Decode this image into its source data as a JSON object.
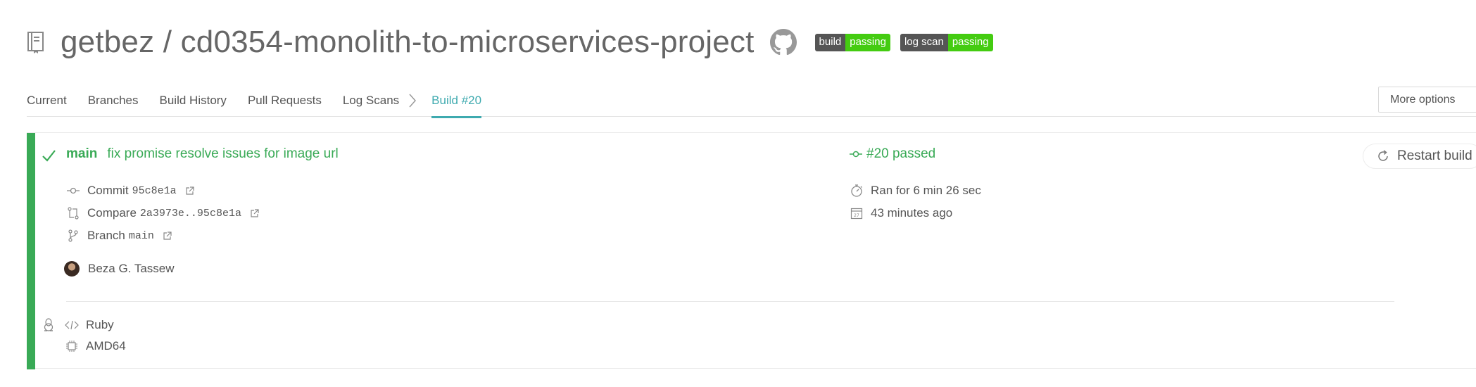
{
  "header": {
    "repo_title": "getbez / cd0354-monolith-to-microservices-project",
    "badges": [
      {
        "left": "build",
        "right": "passing"
      },
      {
        "left": "log scan",
        "right": "passing"
      }
    ]
  },
  "tabs": [
    {
      "label": "Current"
    },
    {
      "label": "Branches"
    },
    {
      "label": "Build History"
    },
    {
      "label": "Pull Requests"
    },
    {
      "label": "Log Scans"
    },
    {
      "label": "Build #20",
      "active": true
    }
  ],
  "more_options_label": "More options",
  "build": {
    "branch": "main",
    "commit_message": "fix promise resolve issues for image url",
    "status": "#20 passed",
    "commit_label": "Commit",
    "commit_sha": "95c8e1a",
    "compare_label": "Compare",
    "compare_range": "2a3973e..95c8e1a",
    "branch_label": "Branch",
    "branch_value": "main",
    "author": "Beza G. Tassew",
    "duration": "Ran for 6 min 26 sec",
    "finished": "43 minutes ago",
    "language": "Ruby",
    "arch": "AMD64",
    "restart_label": "Restart build"
  },
  "colors": {
    "passed": "#39aa56",
    "active_tab": "#3eaaaf",
    "badge_left": "#555555",
    "badge_right": "#44cc11"
  }
}
